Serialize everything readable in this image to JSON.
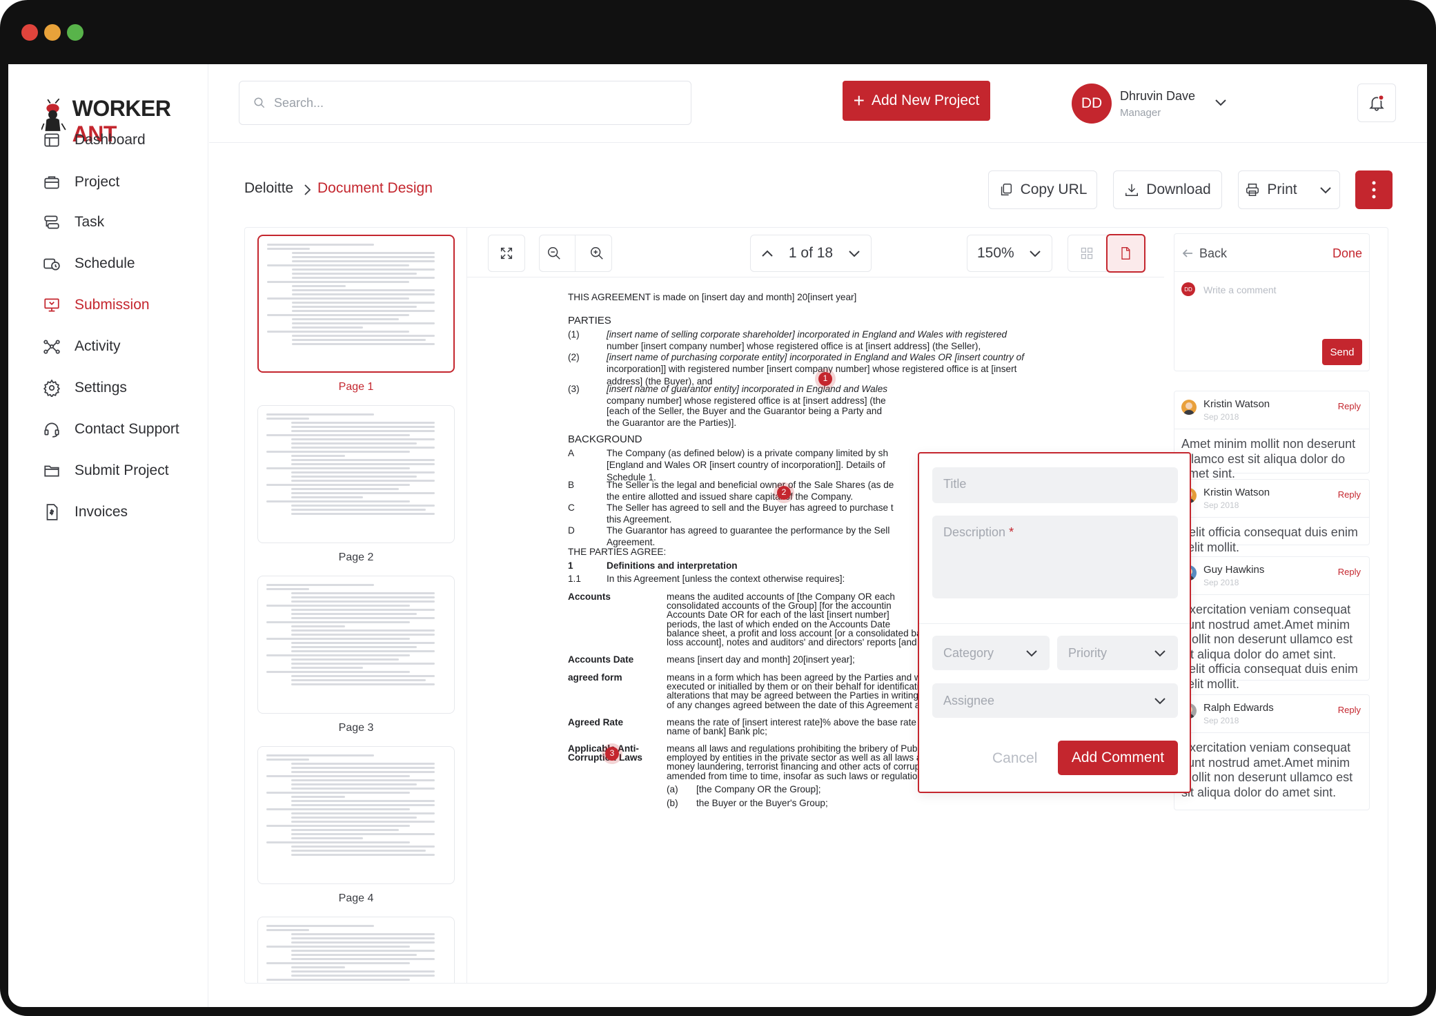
{
  "brand": {
    "name_part1": "WORKER",
    "name_part2": " ANT"
  },
  "search": {
    "placeholder": "Search..."
  },
  "header": {
    "add_project_label": "Add New Project",
    "user_initials": "DD",
    "user_name": "Dhruvin Dave",
    "user_role": "Manager"
  },
  "sidebar": {
    "items": [
      {
        "label": "Dashboard",
        "icon": "dashboard-icon"
      },
      {
        "label": "Project",
        "icon": "briefcase-icon"
      },
      {
        "label": "Task",
        "icon": "task-icon"
      },
      {
        "label": "Schedule",
        "icon": "schedule-icon"
      },
      {
        "label": "Submission",
        "icon": "submission-icon",
        "active": true
      },
      {
        "label": "Activity",
        "icon": "activity-icon"
      },
      {
        "label": "Settings",
        "icon": "gear-icon"
      },
      {
        "label": "Contact Support",
        "icon": "headset-icon"
      },
      {
        "label": "Submit Project",
        "icon": "folder-icon"
      },
      {
        "label": "Invoices",
        "icon": "invoice-icon"
      }
    ]
  },
  "breadcrumb": {
    "parent": "Deloitte",
    "current": "Document Design"
  },
  "toolbar": {
    "copy_url": "Copy URL",
    "download": "Download",
    "print": "Print"
  },
  "viewer": {
    "page_indicator": "1 of 18",
    "zoom": "150%"
  },
  "thumbnails": [
    "Page 1",
    "Page 2",
    "Page 3",
    "Page 4"
  ],
  "document": {
    "intro": "THIS AGREEMENT is made on [insert day and month] 20[insert year]",
    "parties_heading": "PARTIES",
    "parties": [
      {
        "num": "(1)",
        "line1": "[insert name of selling corporate shareholder] incorporated in England and Wales with registered",
        "line2": "number [insert company number] whose registered office is at [insert address] (the Seller),"
      },
      {
        "num": "(2)",
        "line1": "[insert name of purchasing corporate entity] incorporated in England and Wales OR [insert country of",
        "line2": "incorporation]] with registered number [insert company number] whose registered office is at [insert",
        "line3": "address] (the Buyer), and"
      },
      {
        "num": "(3)",
        "line1": "[insert name of guarantor entity] incorporated in England and Wales",
        "line2": "company number] whose registered office is at [insert address] (the"
      }
    ],
    "parties_note_1": "[each of the Seller, the Buyer and the Guarantor being a Party and",
    "parties_note_2": "the Guarantor are the Parties)].",
    "background_heading": "BACKGROUND",
    "background": [
      {
        "num": "A",
        "line1": "The Company (as defined below) is a private company limited by sh",
        "line2": "[England and Wales OR [insert country of incorporation]]. Details of",
        "line3": "Schedule 1."
      },
      {
        "num": "B",
        "line1": "The Seller is the legal and beneficial owner of the Sale Shares (as de",
        "line2": "the entire allotted and issued share capital of the Company."
      },
      {
        "num": "C",
        "line1": "The Seller has agreed to sell and the Buyer has agreed to purchase t",
        "line2": "this Agreement."
      },
      {
        "num": "D",
        "line1": "The Guarantor has agreed to guarantee the performance by the Sell",
        "line2": "Agreement."
      }
    ],
    "agree_heading": "THE PARTIES AGREE:",
    "clause_num": "1",
    "clause_title": "Definitions and interpretation",
    "clause_sub_num": "1.1",
    "clause_sub": "In this Agreement [unless the context otherwise requires]:",
    "definitions": [
      {
        "term": "Accounts",
        "lines": [
          "means the audited accounts of [the Company OR each",
          "consolidated accounts of the Group] [for the accountin",
          "Accounts Date OR for each of the last [insert number]",
          "periods, the last of which ended on the Accounts Date",
          "balance sheet, a profit and loss account [or a consolidated balance sheet and profit and",
          "loss account], notes and auditors' and directors' reports [and a cash flow statement];"
        ]
      },
      {
        "term": "Accounts Date",
        "lines": [
          "means [insert day and month] 20[insert year];"
        ]
      },
      {
        "term": "agreed form",
        "lines": [
          "means in a form which has been agreed by the Parties and which has been duly",
          "executed or initialled by them or on their behalf for identification purposes with any",
          "alterations that may be agreed between the Parties in writing, including to take account",
          "of any changes agreed between the date of this Agreement and Completion;"
        ]
      },
      {
        "term": "Agreed Rate",
        "lines": [
          "means the rate of [insert interest rate]% above the base rate from time to time of [insert",
          "name of bank] Bank plc;"
        ]
      },
      {
        "term": "Applicable Anti-Corruption Laws",
        "term1": "Applicable Anti-",
        "term2": "Corruption Laws",
        "lines": [
          "means all laws and regulations prohibiting the bribery of Public Officials or individuals",
          "employed by entities in the private sector as well as all laws and regulations prohibiting",
          "money laundering, terrorist financing and other acts of corruption, as such laws are",
          "amended from time to time, insofar as such laws or regulations are applicable to:"
        ]
      }
    ],
    "sub_items": [
      {
        "num": "(a)",
        "text": "[the Company OR the Group];"
      },
      {
        "num": "(b)",
        "text": "the Buyer or the Buyer's Group;"
      }
    ]
  },
  "markers": [
    "1",
    "2",
    "3"
  ],
  "comment_form": {
    "title_placeholder": "Title",
    "description_placeholder": "Description",
    "required_mark": "*",
    "category_placeholder": "Category",
    "priority_placeholder": "Priority",
    "assignee_placeholder": "Assignee",
    "cancel_label": "Cancel",
    "submit_label": "Add Comment"
  },
  "comments_panel": {
    "back_label": "Back",
    "done_label": "Done",
    "input_avatar": "DD",
    "input_placeholder": "Write a comment",
    "send_label": "Send",
    "reply_label": "Reply",
    "comments": [
      {
        "author": "Kristin Watson",
        "date": "Sep 2018",
        "body": "Amet minim mollit non deserunt ullamco est sit aliqua dolor do amet sint."
      },
      {
        "author": "Kristin Watson",
        "date": "Sep 2018",
        "body": "Velit officia consequat duis enim velit mollit."
      },
      {
        "author": "Guy Hawkins",
        "date": "Sep 2018",
        "body": " Exercitation veniam consequat sunt nostrud amet.Amet minim mollit non deserunt ullamco est sit aliqua dolor do amet sint. Velit officia consequat duis enim velit mollit."
      },
      {
        "author": "Ralph Edwards",
        "date": "Sep 2018",
        "body": "Exercitation veniam consequat sunt nostrud amet.Amet minim mollit non deserunt ullamco est sit aliqua dolor do amet sint."
      }
    ]
  },
  "colors": {
    "accent": "#c4262e",
    "text": "#2e2f33",
    "muted": "#9aa0a8",
    "border": "#e3e5ea"
  }
}
